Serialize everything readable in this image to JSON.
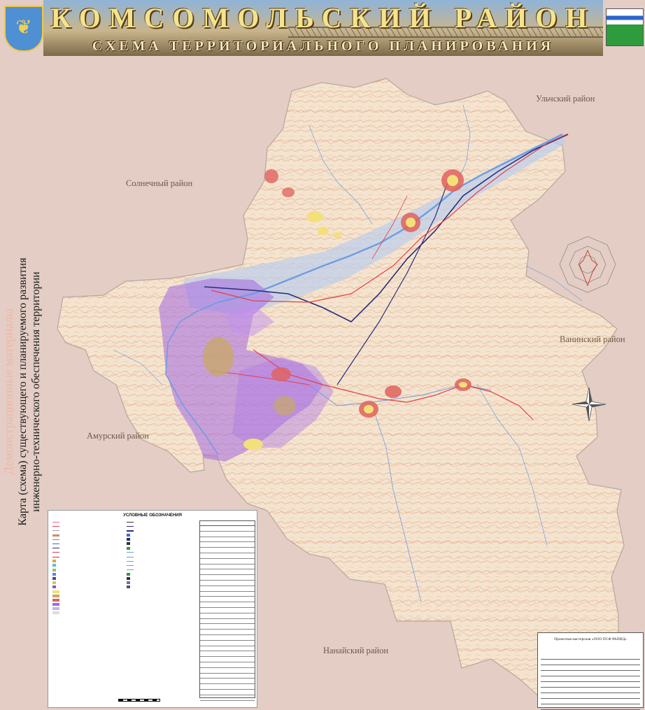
{
  "header": {
    "title": "КОМСОМОЛЬСКИЙ РАЙОН",
    "subtitle": "СХЕМА ТЕРРИТОРИАЛЬНОГО ПЛАНИРОВАНИЯ"
  },
  "side_title": {
    "demo": "Демонстрационные материалы",
    "line1": "Карта (схема) существующего и планируемого развития",
    "line2": "инженерно-технического обеспечения территории"
  },
  "districts": {
    "ulchsky": "Ульчский район",
    "solnechny": "Солнечный район",
    "vaninsky": "Ванинский район",
    "amursky": "Амурский район",
    "nanaysky": "Нанайский район"
  },
  "legend": {
    "title": "УСЛОВНЫЕ ОБОЗНАЧЕНИЯ"
  },
  "title_block": {
    "organization": "Проектная мастерская «ООО ПСФ РАПИД»"
  },
  "colors": {
    "territory": "#f4e6d2",
    "river": "#6f9de0",
    "zone_violet": "#a468e2",
    "settlement_red": "#e0625c",
    "settlement_yellow": "#f3e07a",
    "road_red": "#e0404a",
    "pipeline_navy": "#2a2c7a",
    "background": "#e3cdc4"
  }
}
